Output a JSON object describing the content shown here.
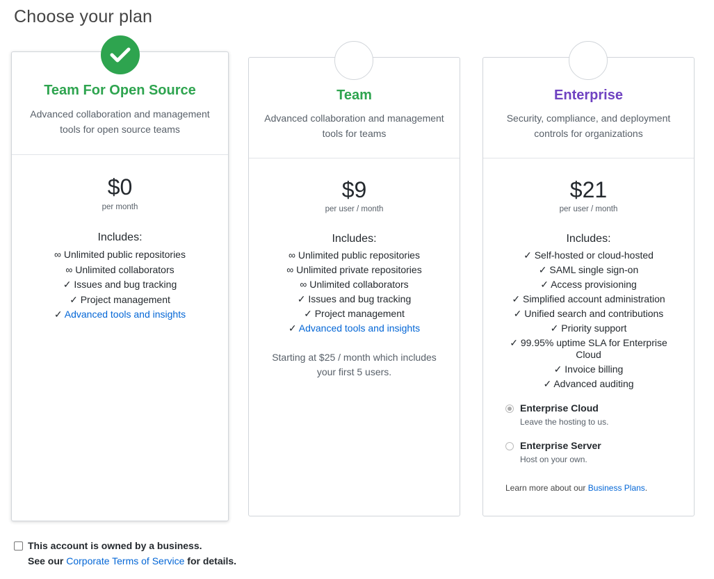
{
  "page": {
    "title": "Choose your plan"
  },
  "plans": [
    {
      "name": "Team For Open Source",
      "description": "Advanced collaboration and management tools for open source teams",
      "price": "$0",
      "price_unit": "per month",
      "includes_title": "Includes:",
      "features": [
        {
          "mark": "∞",
          "text": "Unlimited public repositories"
        },
        {
          "mark": "∞",
          "text": "Unlimited collaborators"
        },
        {
          "mark": "✓",
          "text": "Issues and bug tracking"
        },
        {
          "mark": "✓",
          "text": "Project management"
        },
        {
          "mark": "✓",
          "text": "Advanced tools and insights"
        }
      ]
    },
    {
      "name": "Team",
      "description": "Advanced collaboration and management tools for teams",
      "price": "$9",
      "price_unit": "per user / month",
      "includes_title": "Includes:",
      "features": [
        {
          "mark": "∞",
          "text": "Unlimited public repositories"
        },
        {
          "mark": "∞",
          "text": "Unlimited private repositories"
        },
        {
          "mark": "∞",
          "text": "Unlimited collaborators"
        },
        {
          "mark": "✓",
          "text": "Issues and bug tracking"
        },
        {
          "mark": "✓",
          "text": "Project management"
        },
        {
          "mark": "✓",
          "text": "Advanced tools and insights"
        }
      ],
      "note": "Starting at $25 / month which includes your first 5 users."
    },
    {
      "name": "Enterprise",
      "description": "Security, compliance, and deployment controls for organizations",
      "price": "$21",
      "price_unit": "per user / month",
      "includes_title": "Includes:",
      "features": [
        {
          "mark": "✓",
          "text": "Self-hosted or cloud-hosted"
        },
        {
          "mark": "✓",
          "text": "SAML single sign-on"
        },
        {
          "mark": "✓",
          "text": "Access provisioning"
        },
        {
          "mark": "✓",
          "text": "Simplified account administration"
        },
        {
          "mark": "✓",
          "text": "Unified search and contributions"
        },
        {
          "mark": "✓",
          "text": "Priority support"
        },
        {
          "mark": "✓",
          "text": "99.95% uptime SLA for Enterprise Cloud"
        },
        {
          "mark": "✓",
          "text": "Invoice billing"
        },
        {
          "mark": "✓",
          "text": "Advanced auditing"
        }
      ],
      "options": [
        {
          "label": "Enterprise Cloud",
          "sub": "Leave the hosting to us."
        },
        {
          "label": "Enterprise Server",
          "sub": "Host on your own."
        }
      ],
      "learn_more_prefix": "Learn more about our",
      "learn_more_link": "Business Plans",
      "learn_more_suffix": "."
    }
  ],
  "business": {
    "label": "This account is owned by a business.",
    "sub_prefix": "See our",
    "sub_link": "Corporate Terms of Service",
    "sub_suffix": "for details."
  },
  "colors": {
    "green": "#2ea44f",
    "purple": "#6f42c1",
    "link": "#0366d6"
  }
}
